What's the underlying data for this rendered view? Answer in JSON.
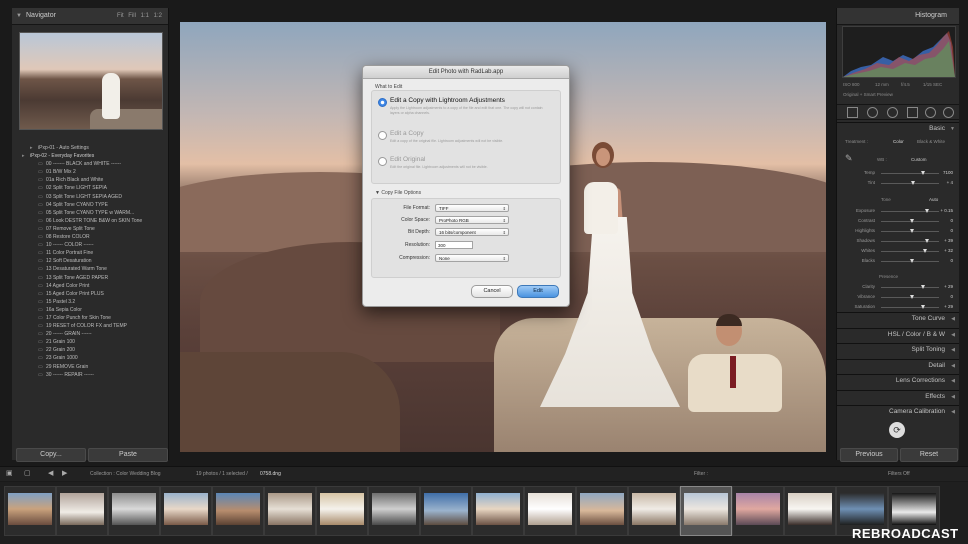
{
  "left_panel": {
    "navigator_title": "Navigator",
    "zoom_options": [
      "Fit",
      "Fill",
      "1:1",
      "1:2"
    ],
    "presets": [
      {
        "label": "iPxp-01 - Auto Settings",
        "level": "sub"
      },
      {
        "label": "iPxp-02 - Everyday Favorites",
        "level": "folder"
      },
      {
        "label": "00 ------- BLACK and WHITE ------",
        "level": "item"
      },
      {
        "label": "01 B/W Mix 2",
        "level": "item"
      },
      {
        "label": "01a Rich Black and White",
        "level": "item"
      },
      {
        "label": "02 Split Tone LIGHT SEPIA",
        "level": "item"
      },
      {
        "label": "03 Split Tone LIGHT SEPIA AGED",
        "level": "item"
      },
      {
        "label": "04 Split Tone CYANO TYPE",
        "level": "item"
      },
      {
        "label": "05 Split Tone CYANO TYPE w WARM...",
        "level": "item"
      },
      {
        "label": "06 Look DESTR TONE B&W on SKIN Tone",
        "level": "item"
      },
      {
        "label": "07 Remove Split Tone",
        "level": "item"
      },
      {
        "label": "08 Restore COLOR",
        "level": "item"
      },
      {
        "label": "10 ------ COLOR ------",
        "level": "item"
      },
      {
        "label": "11 Color Portrait Fine",
        "level": "item"
      },
      {
        "label": "12 Soft Desaturation",
        "level": "item"
      },
      {
        "label": "13 Desaturated Warm Tone",
        "level": "item"
      },
      {
        "label": "13 Split Tone AGED PAPER",
        "level": "item"
      },
      {
        "label": "14 Aged Color Print",
        "level": "item"
      },
      {
        "label": "15 Aged Color Print PLUS",
        "level": "item"
      },
      {
        "label": "15 Pastel 3.2",
        "level": "item"
      },
      {
        "label": "16a Sepia Color",
        "level": "item"
      },
      {
        "label": "17 Color Punch for Skin Tone",
        "level": "item"
      },
      {
        "label": "19 RESET of COLOR FX and TEMP",
        "level": "item"
      },
      {
        "label": "20 ------ GRAIN ------",
        "level": "item"
      },
      {
        "label": "21 Grain 100",
        "level": "item"
      },
      {
        "label": "22 Grain 200",
        "level": "item"
      },
      {
        "label": "23 Grain 1000",
        "level": "item"
      },
      {
        "label": "29 REMOVE Grain",
        "level": "item"
      },
      {
        "label": "30 ------ REPAIR ------",
        "level": "item"
      }
    ],
    "copy_label": "Copy...",
    "paste_label": "Paste"
  },
  "dialog": {
    "title": "Edit Photo with RadLab.app",
    "what_to_edit": "What to Edit",
    "options": [
      {
        "title": "Edit a Copy with Lightroom Adjustments",
        "desc": "Apply the Lightroom adjustments to a copy of the file and edit that one. The copy will not contain layers or alpha channels.",
        "selected": true
      },
      {
        "title": "Edit a Copy",
        "desc": "Edit a copy of the original file. Lightroom adjustments will not be visible.",
        "selected": false
      },
      {
        "title": "Edit Original",
        "desc": "Edit the original file. Lightroom adjustments will not be visible.",
        "selected": false
      }
    ],
    "copy_file_options": "Copy File Options",
    "fields": {
      "file_format": {
        "label": "File Format:",
        "value": "TIFF"
      },
      "color_space": {
        "label": "Color Space:",
        "value": "ProPhoto RGB"
      },
      "bit_depth": {
        "label": "Bit Depth:",
        "value": "16 bits/component"
      },
      "resolution": {
        "label": "Resolution:",
        "value": "300"
      },
      "compression": {
        "label": "Compression:",
        "value": "None"
      }
    },
    "cancel_label": "Cancel",
    "edit_label": "Edit"
  },
  "right_panel": {
    "histogram_title": "Histogram",
    "hist_info": [
      "ISO 800",
      "12 mm",
      "f/4.5",
      "1/15 SEC"
    ],
    "original_photo_label": "Original + Smart Preview",
    "basic_title": "Basic",
    "treatment_label": "Treatment :",
    "color_label": "Color",
    "bw_label": "Black & White",
    "wb_label": "WB :",
    "wb_value": "Custom",
    "temp": {
      "label": "Temp",
      "value": "7100"
    },
    "tint": {
      "label": "Tint",
      "value": "+ 4"
    },
    "tone_label": "Tone",
    "auto_label": "Auto",
    "tone_sliders": [
      {
        "label": "Exposure",
        "value": "+ 0.15"
      },
      {
        "label": "Contrast",
        "value": "0"
      },
      {
        "label": "Highlights",
        "value": "0"
      },
      {
        "label": "Shadows",
        "value": "+ 39"
      },
      {
        "label": "Whites",
        "value": "+ 32"
      },
      {
        "label": "Blacks",
        "value": "0"
      }
    ],
    "presence_label": "Presence",
    "presence_sliders": [
      {
        "label": "Clarity",
        "value": "+ 29"
      },
      {
        "label": "Vibrance",
        "value": "0"
      },
      {
        "label": "Saturation",
        "value": "+ 29"
      }
    ],
    "sections": [
      "Tone Curve",
      "HSL / Color / B & W",
      "Split Toning",
      "Detail",
      "Lens Corrections",
      "Effects",
      "Camera Calibration"
    ],
    "previous_label": "Previous",
    "reset_label": "Reset"
  },
  "toolbar": {
    "collection": "Collection : Color Wedding Blog",
    "count": "19 photos / 1 selected /",
    "filename": "0758.dng",
    "filter_label": "Filter :",
    "filters_off": "Filters Off"
  },
  "watermark": "REBROADCAST",
  "colors": {
    "accent": "#3d86e6",
    "panel": "#2a2a2a",
    "background": "#1a1a1a"
  }
}
